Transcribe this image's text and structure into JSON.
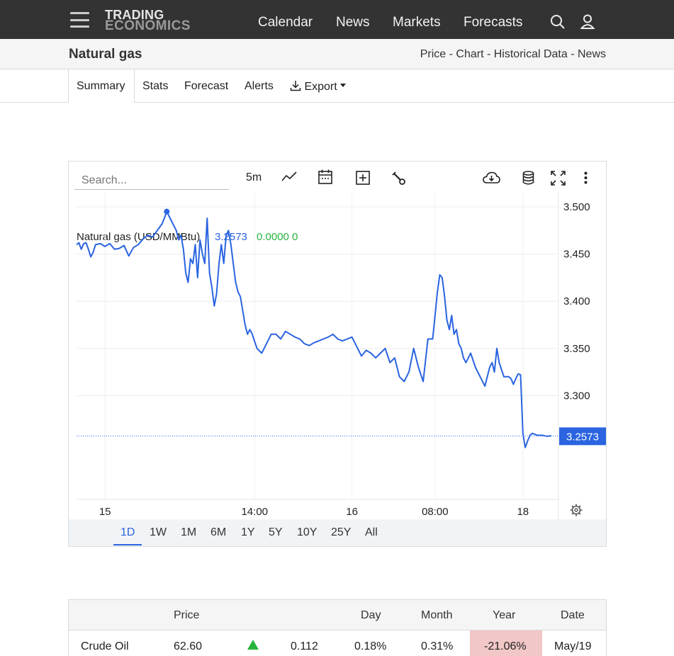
{
  "nav": {
    "logo_line1": "TRADING",
    "logo_line2": "ECONOMICS",
    "links": [
      "Calendar",
      "News",
      "Markets",
      "Forecasts"
    ]
  },
  "subheader": {
    "title": "Natural gas",
    "links": "Price - Chart - Historical Data - News"
  },
  "tabs": {
    "summary": "Summary",
    "stats": "Stats",
    "forecast": "Forecast",
    "alerts": "Alerts",
    "export": "Export"
  },
  "chart_toolbar": {
    "search_placeholder": "Search...",
    "interval": "5m"
  },
  "chart_data": {
    "type": "line",
    "legend_name": "Natural gas (USD/MMBtu)",
    "legend_value": "3.2573",
    "legend_change": "0.0000 0",
    "last_price_label": "3.2573",
    "last_price": 3.2573,
    "ylim": [
      3.19,
      3.515
    ],
    "y_ticks": [
      "3.500",
      "3.450",
      "3.400",
      "3.350",
      "3.300"
    ],
    "y_tick_values": [
      3.5,
      3.45,
      3.4,
      3.35,
      3.3
    ],
    "x_ticks": [
      "15",
      "14:00",
      "16",
      "08:00",
      "18"
    ],
    "x_tick_positions": [
      0.06,
      0.375,
      0.58,
      0.755,
      0.94
    ],
    "x": [
      0,
      0.005,
      0.01,
      0.015,
      0.02,
      0.025,
      0.03,
      0.035,
      0.04,
      0.05,
      0.06,
      0.07,
      0.08,
      0.09,
      0.1,
      0.11,
      0.12,
      0.13,
      0.14,
      0.15,
      0.16,
      0.17,
      0.18,
      0.185,
      0.19,
      0.2,
      0.21,
      0.215,
      0.22,
      0.225,
      0.23,
      0.235,
      0.24,
      0.245,
      0.25,
      0.255,
      0.26,
      0.265,
      0.27,
      0.275,
      0.28,
      0.285,
      0.29,
      0.295,
      0.3,
      0.305,
      0.31,
      0.315,
      0.32,
      0.325,
      0.33,
      0.335,
      0.34,
      0.345,
      0.35,
      0.355,
      0.36,
      0.365,
      0.37,
      0.38,
      0.39,
      0.4,
      0.41,
      0.42,
      0.43,
      0.44,
      0.45,
      0.46,
      0.47,
      0.48,
      0.49,
      0.5,
      0.51,
      0.52,
      0.53,
      0.54,
      0.55,
      0.56,
      0.57,
      0.58,
      0.59,
      0.6,
      0.61,
      0.62,
      0.63,
      0.64,
      0.65,
      0.66,
      0.67,
      0.68,
      0.69,
      0.7,
      0.71,
      0.72,
      0.73,
      0.74,
      0.75,
      0.76,
      0.765,
      0.77,
      0.775,
      0.78,
      0.785,
      0.79,
      0.795,
      0.8,
      0.805,
      0.81,
      0.815,
      0.82,
      0.825,
      0.83,
      0.84,
      0.85,
      0.86,
      0.87,
      0.875,
      0.88,
      0.885,
      0.89,
      0.9,
      0.91,
      0.915,
      0.92,
      0.925,
      0.93,
      0.935,
      0.94,
      0.945,
      0.95,
      0.955,
      0.96,
      0.97,
      0.98,
      0.99,
      1.0
    ],
    "values": [
      3.46,
      3.462,
      3.455,
      3.461,
      3.462,
      3.455,
      3.447,
      3.452,
      3.46,
      3.461,
      3.458,
      3.461,
      3.455,
      3.456,
      3.459,
      3.448,
      3.457,
      3.46,
      3.466,
      3.47,
      3.468,
      3.475,
      3.482,
      3.488,
      3.495,
      3.485,
      3.475,
      3.465,
      3.47,
      3.455,
      3.43,
      3.42,
      3.445,
      3.44,
      3.46,
      3.425,
      3.465,
      3.45,
      3.44,
      3.488,
      3.43,
      3.415,
      3.395,
      3.408,
      3.44,
      3.46,
      3.44,
      3.47,
      3.475,
      3.46,
      3.44,
      3.42,
      3.41,
      3.405,
      3.39,
      3.375,
      3.365,
      3.37,
      3.365,
      3.35,
      3.345,
      3.355,
      3.365,
      3.365,
      3.36,
      3.368,
      3.365,
      3.362,
      3.36,
      3.355,
      3.353,
      3.356,
      3.358,
      3.36,
      3.362,
      3.365,
      3.36,
      3.358,
      3.36,
      3.362,
      3.352,
      3.342,
      3.348,
      3.345,
      3.34,
      3.345,
      3.35,
      3.335,
      3.34,
      3.32,
      3.315,
      3.325,
      3.35,
      3.33,
      3.315,
      3.36,
      3.36,
      3.41,
      3.428,
      3.425,
      3.405,
      3.38,
      3.37,
      3.385,
      3.365,
      3.37,
      3.355,
      3.35,
      3.34,
      3.335,
      3.34,
      3.345,
      3.33,
      3.32,
      3.31,
      3.33,
      3.335,
      3.325,
      3.35,
      3.335,
      3.32,
      3.32,
      3.318,
      3.312,
      3.318,
      3.323,
      3.322,
      3.26,
      3.245,
      3.252,
      3.258,
      3.26,
      3.258,
      3.258,
      3.257,
      3.2573
    ]
  },
  "ranges": [
    "1D",
    "1W",
    "1M",
    "6M",
    "1Y",
    "5Y",
    "10Y",
    "25Y",
    "All"
  ],
  "table": {
    "headers": {
      "price": "Price",
      "day": "Day",
      "month": "Month",
      "year": "Year",
      "date": "Date"
    },
    "row": {
      "name": "Crude Oil",
      "price": "62.60",
      "change": "0.112",
      "day": "0.18%",
      "month": "0.31%",
      "year": "-21.06%",
      "date": "May/19"
    }
  },
  "colors": {
    "line": "#2a64e0",
    "up": "#28b43c",
    "year_negative_bg": "#f1c7c7",
    "topbar": "#333333"
  }
}
